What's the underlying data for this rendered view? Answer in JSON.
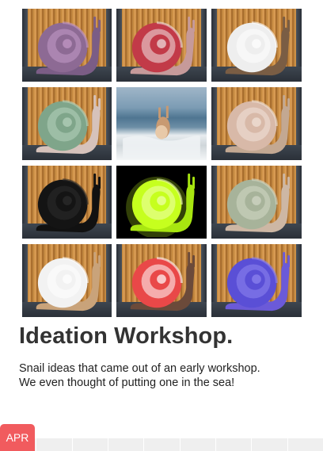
{
  "gallery": {
    "tiles": [
      {
        "name": "purple-glitter-snail",
        "shell": "#8d6a94",
        "shell_light": "#c49ac8",
        "body": "#7b5d86"
      },
      {
        "name": "peppermint-snail",
        "shell": "#c23a48",
        "shell_light": "#f0e6e6",
        "body": "#c69a9a"
      },
      {
        "name": "ice-cream-cone-snail",
        "shell": "#eeeeee",
        "shell_light": "#ffffff",
        "body": "#7a5d44"
      },
      {
        "name": "mint-green-snail",
        "shell": "#7fa58a",
        "shell_light": "#b7d3bd",
        "body": "#d6c2bb"
      },
      {
        "name": "sea-snail",
        "shell": "#c89a72",
        "shell_light": "#e8c9a8",
        "body": "#c89a72"
      },
      {
        "name": "sprinkle-snail",
        "shell": "#d8b9a8",
        "shell_light": "#f2e4da",
        "body": "#c3a892"
      },
      {
        "name": "black-snail",
        "shell": "#141414",
        "shell_light": "#2c2c2c",
        "body": "#111111"
      },
      {
        "name": "neon-glow-snail",
        "shell": "#c6ff1e",
        "shell_light": "#f0ffb0",
        "body": "#a8e610"
      },
      {
        "name": "pastel-dot-snail",
        "shell": "#a7b39a",
        "shell_light": "#d3d9c7",
        "body": "#cdb7a4"
      },
      {
        "name": "white-tan-snail",
        "shell": "#f2f2f2",
        "shell_light": "#ffffff",
        "body": "#c9a37a"
      },
      {
        "name": "red-cap-sprinkle-snail",
        "shell": "#e94848",
        "shell_light": "#ffffff",
        "body": "#6b4a3a"
      },
      {
        "name": "blue-violet-snail",
        "shell": "#5a4fd6",
        "shell_light": "#8f86f0",
        "body": "#6b5ad8"
      }
    ]
  },
  "section": {
    "title": "Ideation Workshop.",
    "description_line1": "Snail ideas that came out of an early workshop.",
    "description_line2": "We even thought of putting one in the sea!"
  },
  "timeline": {
    "current_month": "APR",
    "accent_color": "#f15b5e",
    "segment_count": 9
  }
}
